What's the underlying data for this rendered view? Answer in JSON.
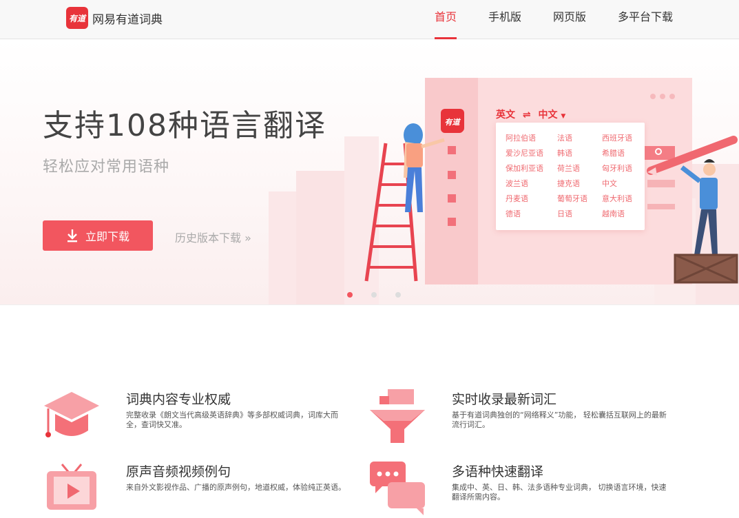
{
  "header": {
    "logo_icon_text": "有道",
    "logo_text": "网易有道词典",
    "nav": [
      {
        "label": "首页",
        "active": true
      },
      {
        "label": "手机版",
        "active": false
      },
      {
        "label": "网页版",
        "active": false
      },
      {
        "label": "多平台下载",
        "active": false
      }
    ]
  },
  "banner": {
    "title": "支持108种语言翻译",
    "subtitle": "轻松应对常用语种",
    "download_label": "立即下载",
    "history_label": "历史版本下载 »",
    "app_icon_text": "有道",
    "lang_from": "英文",
    "lang_swap": "⇌",
    "lang_to": "中文",
    "languages": [
      "阿拉伯语",
      "法语",
      "西班牙语",
      "爱沙尼亚语",
      "韩语",
      "希腊语",
      "保加利亚语",
      "荷兰语",
      "匈牙利语",
      "波兰语",
      "捷克语",
      "中文",
      "丹麦语",
      "葡萄牙语",
      "意大利语",
      "德语",
      "日语",
      "越南语"
    ],
    "carousel_active": 0
  },
  "features": [
    {
      "title": "词典内容专业权威",
      "desc": "完整收录《朗文当代高级英语辞典》等多部权威词典，词库大而全，查词快又准。",
      "icon": "graduation-cap-icon"
    },
    {
      "title": "实时收录最新词汇",
      "desc": "基于有道词典独创的“网络释义”功能，  轻松囊括互联网上的最新流行词汇。",
      "icon": "funnel-icon"
    },
    {
      "title": "原声音频视频例句",
      "desc": "来自外文影视作品、广播的原声例句，地道权威，体验纯正英语。",
      "icon": "tv-play-icon"
    },
    {
      "title": "多语种快速翻译",
      "desc": "集成中、英、日、韩、法多语种专业词典，  切换语言环境，快速翻译所需内容。",
      "icon": "chat-bubbles-icon"
    }
  ],
  "colors": {
    "accent": "#e8333a",
    "button": "#f2565f"
  }
}
